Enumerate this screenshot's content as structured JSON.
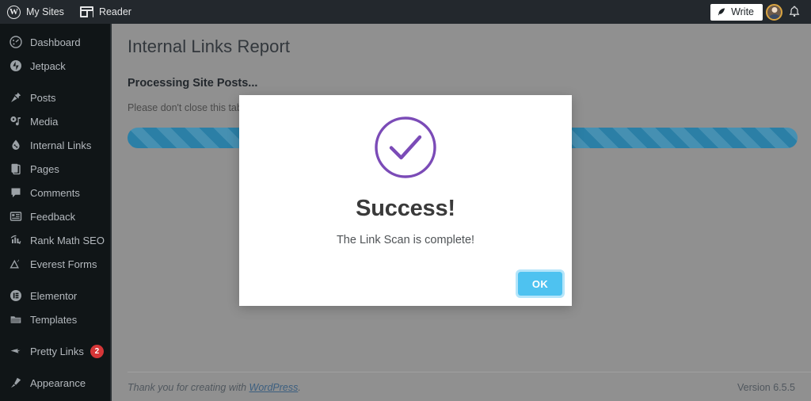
{
  "adminbar": {
    "my_sites": "My Sites",
    "reader": "Reader",
    "write": "Write",
    "wp_logo_glyph": "W",
    "icons": {
      "wordpress": "wordpress-logo-icon",
      "reader": "reader-icon",
      "quill": "quill-pen-icon",
      "avatar": "user-avatar-icon",
      "bell": "notifications-bell-icon"
    }
  },
  "sidebar": {
    "items": [
      {
        "label": "Dashboard",
        "icon": "dashboard-icon",
        "badge": null,
        "gap_after": false
      },
      {
        "label": "Jetpack",
        "icon": "jetpack-icon",
        "badge": null,
        "gap_after": true
      },
      {
        "label": "Posts",
        "icon": "pin-icon",
        "badge": null,
        "gap_after": false
      },
      {
        "label": "Media",
        "icon": "media-icon",
        "badge": null,
        "gap_after": false
      },
      {
        "label": "Internal Links",
        "icon": "internal-links-icon",
        "badge": null,
        "gap_after": false
      },
      {
        "label": "Pages",
        "icon": "pages-icon",
        "badge": null,
        "gap_after": false
      },
      {
        "label": "Comments",
        "icon": "comments-icon",
        "badge": null,
        "gap_after": false
      },
      {
        "label": "Feedback",
        "icon": "feedback-icon",
        "badge": null,
        "gap_after": false
      },
      {
        "label": "Rank Math SEO",
        "icon": "rank-math-icon",
        "badge": null,
        "gap_after": false
      },
      {
        "label": "Everest Forms",
        "icon": "everest-forms-icon",
        "badge": null,
        "gap_after": true
      },
      {
        "label": "Elementor",
        "icon": "elementor-icon",
        "badge": null,
        "gap_after": false
      },
      {
        "label": "Templates",
        "icon": "templates-icon",
        "badge": null,
        "gap_after": true
      },
      {
        "label": "Pretty Links",
        "icon": "pretty-links-icon",
        "badge": "2",
        "gap_after": true
      },
      {
        "label": "Appearance",
        "icon": "appearance-icon",
        "badge": null,
        "gap_after": false
      }
    ]
  },
  "main": {
    "page_title": "Internal Links Report",
    "section_title": "Processing Site Posts...",
    "section_note": "Please don't close this tab o",
    "progress": {
      "percent": 100,
      "fill_color": "#2b7fa6",
      "striped": true,
      "animated": true
    }
  },
  "footer": {
    "thanks_prefix": "Thank you for creating with ",
    "link_label": "WordPress",
    "thanks_suffix": ".",
    "version": "Version 6.5.5"
  },
  "modal": {
    "icon": "success-check-circle-icon",
    "icon_color": "#7b4bb7",
    "title": "Success!",
    "message": "The Link Scan is complete!",
    "ok_label": "OK",
    "ok_color": "#4ec2f0",
    "ok_focus_ring": "#b5e5fa"
  }
}
